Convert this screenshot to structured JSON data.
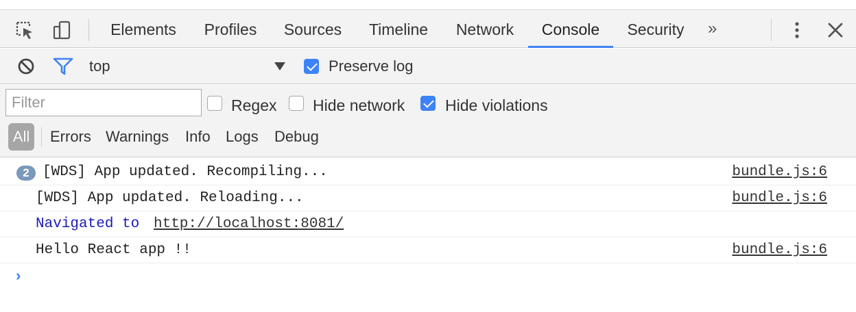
{
  "tabs": [
    {
      "label": "Elements"
    },
    {
      "label": "Profiles"
    },
    {
      "label": "Sources"
    },
    {
      "label": "Timeline"
    },
    {
      "label": "Network"
    },
    {
      "label": "Console"
    },
    {
      "label": "Security"
    }
  ],
  "active_tab": "Console",
  "overflow_label": "»",
  "context": {
    "selected": "top",
    "preserve_log_label": "Preserve log",
    "preserve_log_checked": true
  },
  "filter": {
    "placeholder": "Filter",
    "value": "",
    "regex_label": "Regex",
    "regex_checked": false,
    "hide_network_label": "Hide network",
    "hide_network_checked": false,
    "hide_violations_label": "Hide violations",
    "hide_violations_checked": true
  },
  "levels": [
    {
      "label": "All"
    },
    {
      "label": "Errors"
    },
    {
      "label": "Warnings"
    },
    {
      "label": "Info"
    },
    {
      "label": "Logs"
    },
    {
      "label": "Debug"
    }
  ],
  "messages": [
    {
      "count": "2",
      "text": "[WDS] App updated. Recompiling...",
      "source": "bundle.js:6"
    },
    {
      "text": "[WDS] App updated. Reloading...",
      "source": "bundle.js:6"
    },
    {
      "prefix": "Navigated to ",
      "url": "http://localhost:8081/"
    },
    {
      "text": "Hello React app !!",
      "source": "bundle.js:6"
    }
  ],
  "prompt_symbol": "›",
  "colors": {
    "accent": "#3e82f7",
    "navigation_text": "#1a1ab8",
    "count_badge": "#7b98bd"
  },
  "icons": [
    "inspect-element-icon",
    "device-toolbar-icon",
    "clear-console-icon",
    "filter-icon",
    "dropdown-arrow-icon",
    "more-options-icon",
    "close-icon"
  ]
}
